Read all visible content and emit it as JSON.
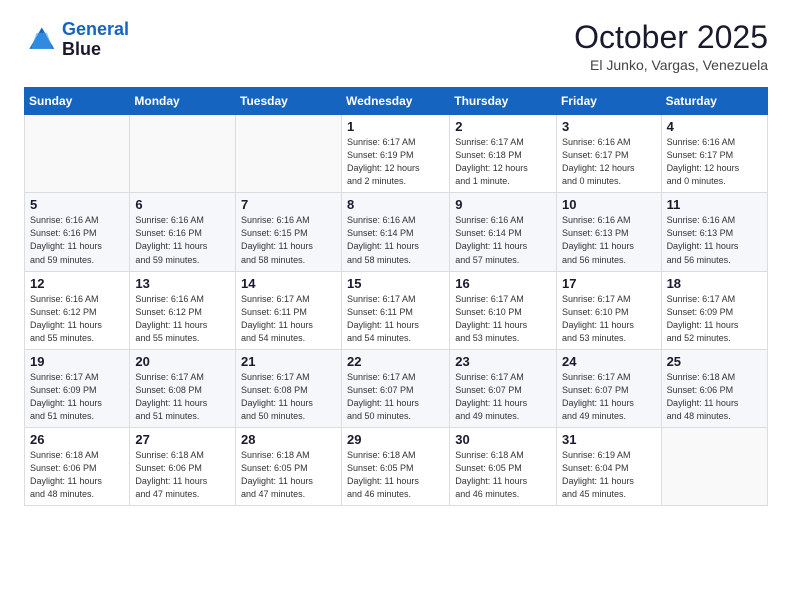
{
  "logo": {
    "line1": "General",
    "line2": "Blue"
  },
  "header": {
    "month": "October 2025",
    "location": "El Junko, Vargas, Venezuela"
  },
  "weekdays": [
    "Sunday",
    "Monday",
    "Tuesday",
    "Wednesday",
    "Thursday",
    "Friday",
    "Saturday"
  ],
  "weeks": [
    [
      {
        "day": "",
        "info": ""
      },
      {
        "day": "",
        "info": ""
      },
      {
        "day": "",
        "info": ""
      },
      {
        "day": "1",
        "info": "Sunrise: 6:17 AM\nSunset: 6:19 PM\nDaylight: 12 hours\nand 2 minutes."
      },
      {
        "day": "2",
        "info": "Sunrise: 6:17 AM\nSunset: 6:18 PM\nDaylight: 12 hours\nand 1 minute."
      },
      {
        "day": "3",
        "info": "Sunrise: 6:16 AM\nSunset: 6:17 PM\nDaylight: 12 hours\nand 0 minutes."
      },
      {
        "day": "4",
        "info": "Sunrise: 6:16 AM\nSunset: 6:17 PM\nDaylight: 12 hours\nand 0 minutes."
      }
    ],
    [
      {
        "day": "5",
        "info": "Sunrise: 6:16 AM\nSunset: 6:16 PM\nDaylight: 11 hours\nand 59 minutes."
      },
      {
        "day": "6",
        "info": "Sunrise: 6:16 AM\nSunset: 6:16 PM\nDaylight: 11 hours\nand 59 minutes."
      },
      {
        "day": "7",
        "info": "Sunrise: 6:16 AM\nSunset: 6:15 PM\nDaylight: 11 hours\nand 58 minutes."
      },
      {
        "day": "8",
        "info": "Sunrise: 6:16 AM\nSunset: 6:14 PM\nDaylight: 11 hours\nand 58 minutes."
      },
      {
        "day": "9",
        "info": "Sunrise: 6:16 AM\nSunset: 6:14 PM\nDaylight: 11 hours\nand 57 minutes."
      },
      {
        "day": "10",
        "info": "Sunrise: 6:16 AM\nSunset: 6:13 PM\nDaylight: 11 hours\nand 56 minutes."
      },
      {
        "day": "11",
        "info": "Sunrise: 6:16 AM\nSunset: 6:13 PM\nDaylight: 11 hours\nand 56 minutes."
      }
    ],
    [
      {
        "day": "12",
        "info": "Sunrise: 6:16 AM\nSunset: 6:12 PM\nDaylight: 11 hours\nand 55 minutes."
      },
      {
        "day": "13",
        "info": "Sunrise: 6:16 AM\nSunset: 6:12 PM\nDaylight: 11 hours\nand 55 minutes."
      },
      {
        "day": "14",
        "info": "Sunrise: 6:17 AM\nSunset: 6:11 PM\nDaylight: 11 hours\nand 54 minutes."
      },
      {
        "day": "15",
        "info": "Sunrise: 6:17 AM\nSunset: 6:11 PM\nDaylight: 11 hours\nand 54 minutes."
      },
      {
        "day": "16",
        "info": "Sunrise: 6:17 AM\nSunset: 6:10 PM\nDaylight: 11 hours\nand 53 minutes."
      },
      {
        "day": "17",
        "info": "Sunrise: 6:17 AM\nSunset: 6:10 PM\nDaylight: 11 hours\nand 53 minutes."
      },
      {
        "day": "18",
        "info": "Sunrise: 6:17 AM\nSunset: 6:09 PM\nDaylight: 11 hours\nand 52 minutes."
      }
    ],
    [
      {
        "day": "19",
        "info": "Sunrise: 6:17 AM\nSunset: 6:09 PM\nDaylight: 11 hours\nand 51 minutes."
      },
      {
        "day": "20",
        "info": "Sunrise: 6:17 AM\nSunset: 6:08 PM\nDaylight: 11 hours\nand 51 minutes."
      },
      {
        "day": "21",
        "info": "Sunrise: 6:17 AM\nSunset: 6:08 PM\nDaylight: 11 hours\nand 50 minutes."
      },
      {
        "day": "22",
        "info": "Sunrise: 6:17 AM\nSunset: 6:07 PM\nDaylight: 11 hours\nand 50 minutes."
      },
      {
        "day": "23",
        "info": "Sunrise: 6:17 AM\nSunset: 6:07 PM\nDaylight: 11 hours\nand 49 minutes."
      },
      {
        "day": "24",
        "info": "Sunrise: 6:17 AM\nSunset: 6:07 PM\nDaylight: 11 hours\nand 49 minutes."
      },
      {
        "day": "25",
        "info": "Sunrise: 6:18 AM\nSunset: 6:06 PM\nDaylight: 11 hours\nand 48 minutes."
      }
    ],
    [
      {
        "day": "26",
        "info": "Sunrise: 6:18 AM\nSunset: 6:06 PM\nDaylight: 11 hours\nand 48 minutes."
      },
      {
        "day": "27",
        "info": "Sunrise: 6:18 AM\nSunset: 6:06 PM\nDaylight: 11 hours\nand 47 minutes."
      },
      {
        "day": "28",
        "info": "Sunrise: 6:18 AM\nSunset: 6:05 PM\nDaylight: 11 hours\nand 47 minutes."
      },
      {
        "day": "29",
        "info": "Sunrise: 6:18 AM\nSunset: 6:05 PM\nDaylight: 11 hours\nand 46 minutes."
      },
      {
        "day": "30",
        "info": "Sunrise: 6:18 AM\nSunset: 6:05 PM\nDaylight: 11 hours\nand 46 minutes."
      },
      {
        "day": "31",
        "info": "Sunrise: 6:19 AM\nSunset: 6:04 PM\nDaylight: 11 hours\nand 45 minutes."
      },
      {
        "day": "",
        "info": ""
      }
    ]
  ]
}
